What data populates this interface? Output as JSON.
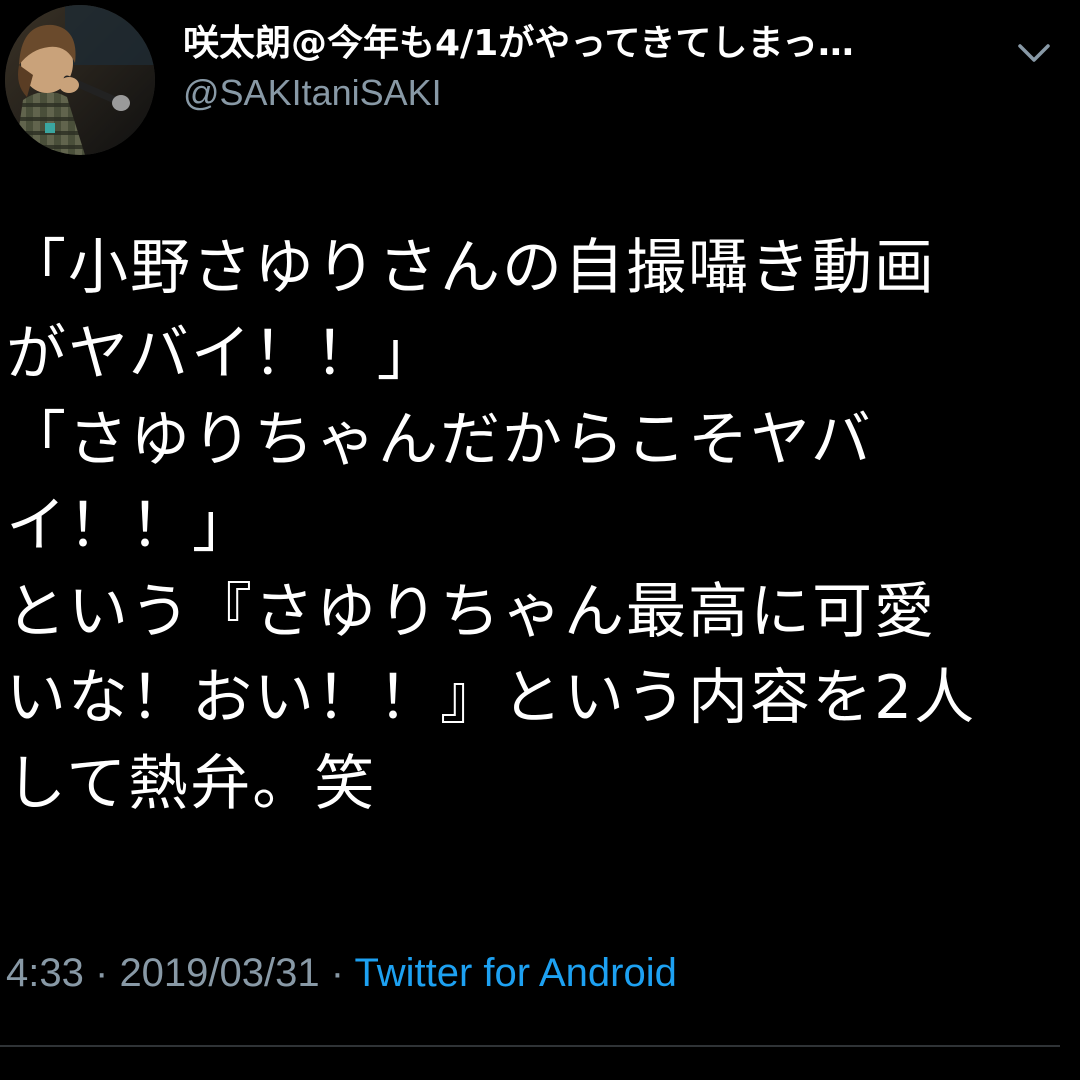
{
  "tweet": {
    "author": {
      "display_name": "咲太朗@今年も4/1がやってきてしまっ…",
      "handle": "@SAKItaniSAKI",
      "avatar_icon": "profile-photo"
    },
    "menu_icon": "chevron-down-icon",
    "body_lines": [
      "「小野さゆりさんの自撮囁き動画",
      "がヤバイ！！」",
      "「さゆりちゃんだからこそヤバ",
      "イ！！」",
      "という『さゆりちゃん最高に可愛",
      "いな！おい！！』という内容を2人",
      "して熱弁。笑"
    ],
    "time": "4:33",
    "separator": "·",
    "date": "2019/03/31",
    "source": "Twitter for Android"
  },
  "colors": {
    "background": "#000000",
    "text": "#ffffff",
    "muted": "#8899a6",
    "link": "#1da1f2",
    "divider": "#2f3336"
  }
}
